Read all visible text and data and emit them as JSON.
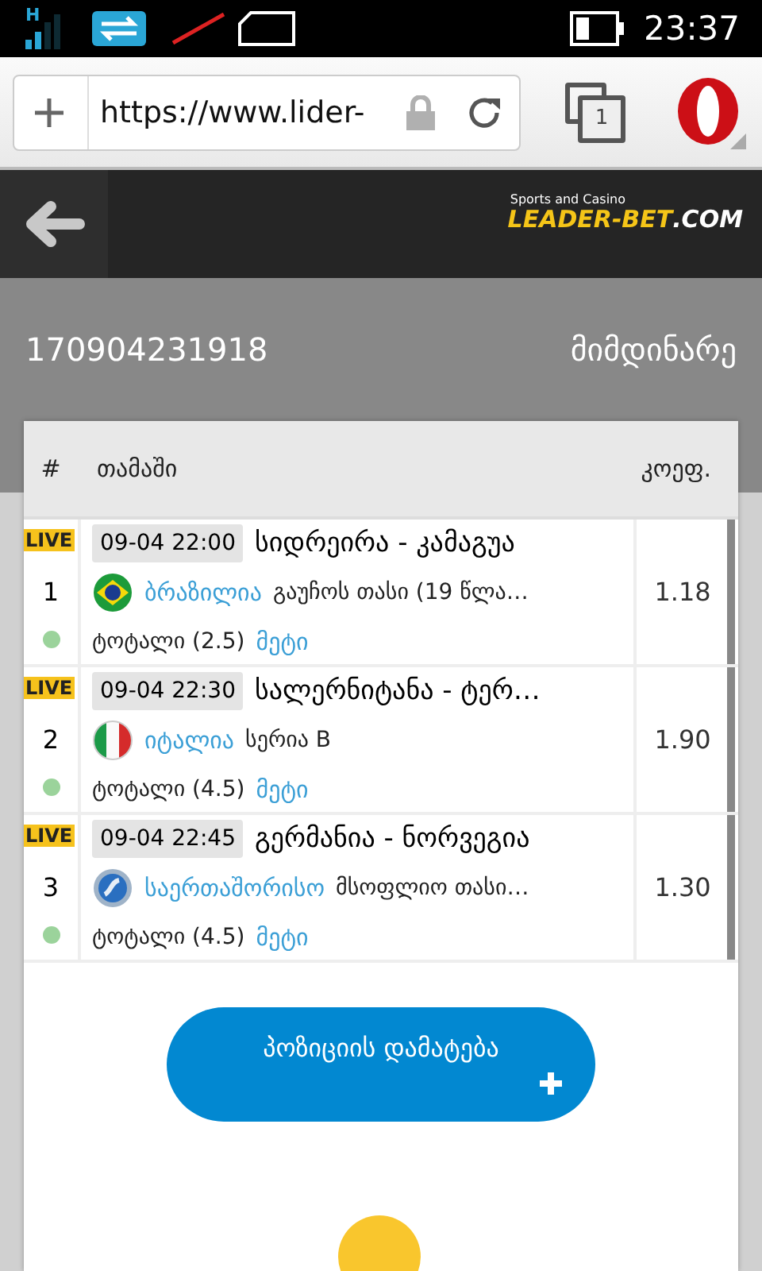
{
  "status_bar": {
    "network": "H",
    "time": "23:37"
  },
  "browser": {
    "url": "https://www.lider-",
    "tabs_count": "1"
  },
  "site_header": {
    "tagline": "Sports and Casino",
    "brand": "LEADER-BET",
    "domain": ".COM"
  },
  "ticket": {
    "number": "170904231918",
    "status": "მიმდინარე"
  },
  "table": {
    "columns": [
      "#",
      "თამაში",
      "კოეფ."
    ],
    "rows": [
      {
        "badge": "LIVE",
        "index": "1",
        "datetime": "09-04 22:00",
        "match": "სიდრეირა - კამაგუა",
        "country": "ბრაზილია",
        "league": "გაუჩოს თასი (19 წლა…",
        "market": "ტოტალი (2.5)",
        "pick": "მეტი",
        "odds": "1.18"
      },
      {
        "badge": "LIVE",
        "index": "2",
        "datetime": "09-04 22:30",
        "match": "სალერნიტანა - ტერ…",
        "country": "იტალია",
        "league": "სერია B",
        "market": "ტოტალი (4.5)",
        "pick": "მეტი",
        "odds": "1.90"
      },
      {
        "badge": "LIVE",
        "index": "3",
        "datetime": "09-04 22:45",
        "match": "გერმანია - ნორვეგია",
        "country": "საერთაშორისო",
        "league": "მსოფლიო თასი…",
        "market": "ტოტალი (4.5)",
        "pick": "მეტი",
        "odds": "1.30"
      }
    ]
  },
  "add_button": {
    "label": "პოზიციის დამატება"
  }
}
